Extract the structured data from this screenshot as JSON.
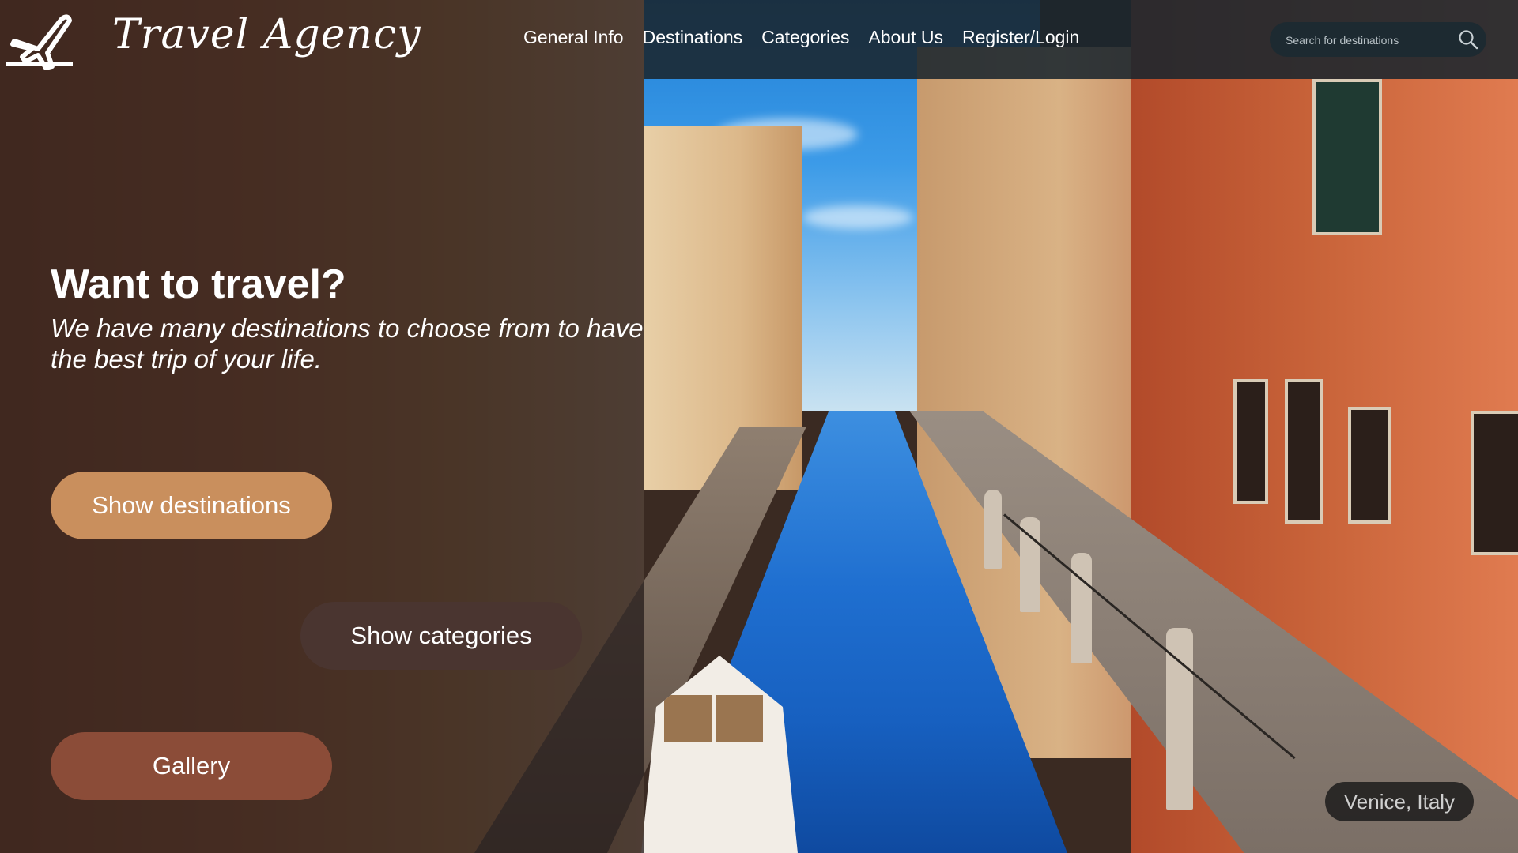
{
  "header": {
    "brand": "Travel Agency",
    "logo_icon": "airplane-icon",
    "nav": [
      {
        "label": "General Info"
      },
      {
        "label": "Destinations"
      },
      {
        "label": "Categories"
      },
      {
        "label": "About Us"
      },
      {
        "label": "Register/Login"
      }
    ],
    "search": {
      "placeholder": "Search for destinations",
      "icon": "search-icon"
    }
  },
  "hero": {
    "title": "Want to travel?",
    "subtitle": "We have many destinations to choose from to have the best trip of your life."
  },
  "buttons": {
    "destinations": "Show destinations",
    "categories": "Show categories",
    "gallery": "Gallery"
  },
  "photo_caption": "Venice, Italy",
  "colors": {
    "destinations_button": "#c98f5d",
    "categories_button": "#4a3530",
    "gallery_button": "#8b4c38",
    "header_bar": "#1a262e"
  }
}
